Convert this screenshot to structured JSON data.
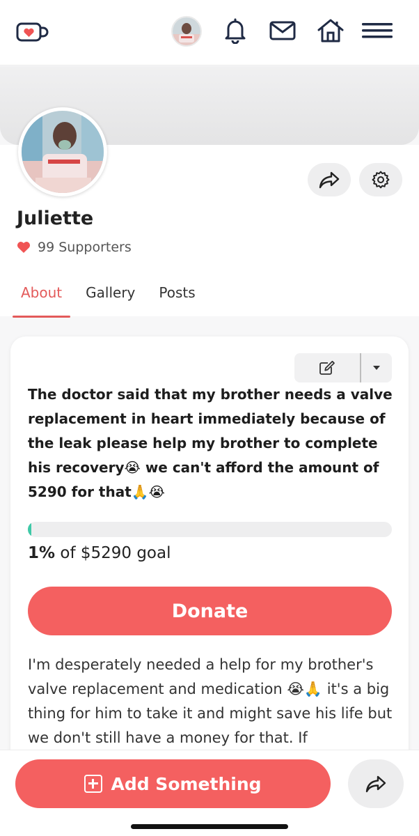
{
  "header": {
    "logo_icon": "kofi-cup-heart-icon",
    "icons": [
      "user-avatar",
      "bell-icon",
      "mail-icon",
      "home-icon",
      "hamburger-menu-icon"
    ]
  },
  "profile": {
    "name": "Juliette",
    "supporters_text": "99 Supporters",
    "tabs": [
      {
        "label": "About",
        "active": true
      },
      {
        "label": "Gallery",
        "active": false
      },
      {
        "label": "Posts",
        "active": false
      }
    ]
  },
  "goal_card": {
    "headline": "The doctor said that my brother needs a valve replacement in heart immediately because of the leak please help my brother to complete his recovery😭 we can't afford the amount of 5290 for that🙏😭",
    "progress_percent": 1,
    "progress_label": "1%",
    "goal_suffix": "of $5290 goal",
    "donate_label": "Donate",
    "body_text": "I'm desperately needed a help for my brother's valve replacement and medication 😭🙏 it's a big thing for him to take it and might save his life but we don't still have a money for that. If"
  },
  "bottom_bar": {
    "add_label": "Add Something"
  },
  "colors": {
    "accent": "#f46060",
    "tab_active": "#e35a5a",
    "progress": "#3ec9a7"
  }
}
